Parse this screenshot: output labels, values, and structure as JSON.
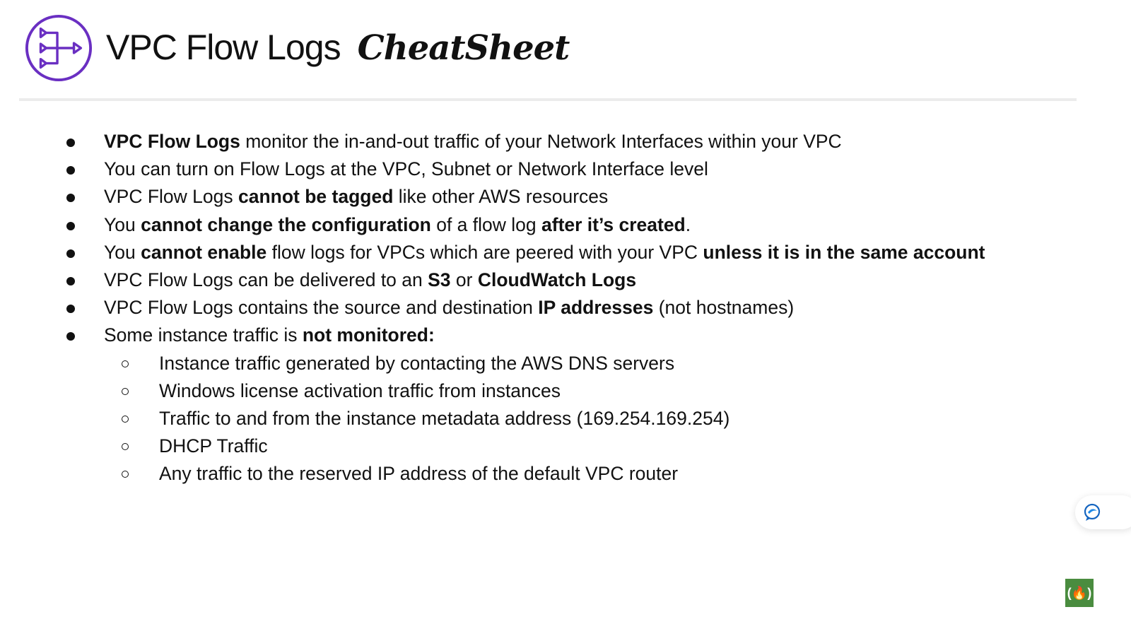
{
  "header": {
    "title": "VPC Flow Logs",
    "title_script": "CheatSheet",
    "logo_icon": "vpc-flow-logs-icon",
    "accent_color": "#6a2fc2"
  },
  "bullets": [
    {
      "level": 1,
      "segments": [
        {
          "text": "VPC Flow Logs",
          "bold": true
        },
        {
          "text": " monitor the in-and-out traffic of your Network Interfaces within your VPC",
          "bold": false
        }
      ]
    },
    {
      "level": 1,
      "segments": [
        {
          "text": "You can turn on Flow Logs at the VPC, Subnet or Network Interface level",
          "bold": false
        }
      ]
    },
    {
      "level": 1,
      "segments": [
        {
          "text": "VPC Flow Logs ",
          "bold": false
        },
        {
          "text": "cannot be tagged",
          "bold": true
        },
        {
          "text": " like other AWS resources",
          "bold": false
        }
      ]
    },
    {
      "level": 1,
      "segments": [
        {
          "text": "You ",
          "bold": false
        },
        {
          "text": "cannot change the configuration",
          "bold": true
        },
        {
          "text": " of a flow log ",
          "bold": false
        },
        {
          "text": "after it’s created",
          "bold": true
        },
        {
          "text": ".",
          "bold": false
        }
      ]
    },
    {
      "level": 1,
      "segments": [
        {
          "text": "You ",
          "bold": false
        },
        {
          "text": "cannot enable",
          "bold": true
        },
        {
          "text": " flow logs for VPCs which are peered with your VPC ",
          "bold": false
        },
        {
          "text": "unless it is in the same account",
          "bold": true
        }
      ]
    },
    {
      "level": 1,
      "segments": [
        {
          "text": "VPC Flow Logs can be delivered to an ",
          "bold": false
        },
        {
          "text": "S3",
          "bold": true
        },
        {
          "text": " or ",
          "bold": false
        },
        {
          "text": "CloudWatch Logs",
          "bold": true
        }
      ]
    },
    {
      "level": 1,
      "segments": [
        {
          "text": "VPC Flow Logs contains the source and destination ",
          "bold": false
        },
        {
          "text": "IP addresses",
          "bold": true
        },
        {
          "text": " (not hostnames)",
          "bold": false
        }
      ]
    },
    {
      "level": 1,
      "segments": [
        {
          "text": "Some instance traffic is ",
          "bold": false
        },
        {
          "text": "not monitored:",
          "bold": true
        }
      ]
    },
    {
      "level": 2,
      "segments": [
        {
          "text": "Instance traffic generated by contacting the AWS DNS servers",
          "bold": false
        }
      ]
    },
    {
      "level": 2,
      "segments": [
        {
          "text": "Windows license activation traffic from instances",
          "bold": false
        }
      ]
    },
    {
      "level": 2,
      "segments": [
        {
          "text": "Traffic to and from the instance metadata address (169.254.169.254)",
          "bold": false
        }
      ]
    },
    {
      "level": 2,
      "segments": [
        {
          "text": "DHCP Traffic",
          "bold": false
        }
      ]
    },
    {
      "level": 2,
      "segments": [
        {
          "text": "Any traffic to the reserved IP address of the default VPC router",
          "bold": false
        }
      ]
    }
  ],
  "widgets": {
    "chat_icon": "chat-bubble-icon",
    "brand_badge": "(🔥)",
    "brand_color": "#4a8c3f"
  }
}
